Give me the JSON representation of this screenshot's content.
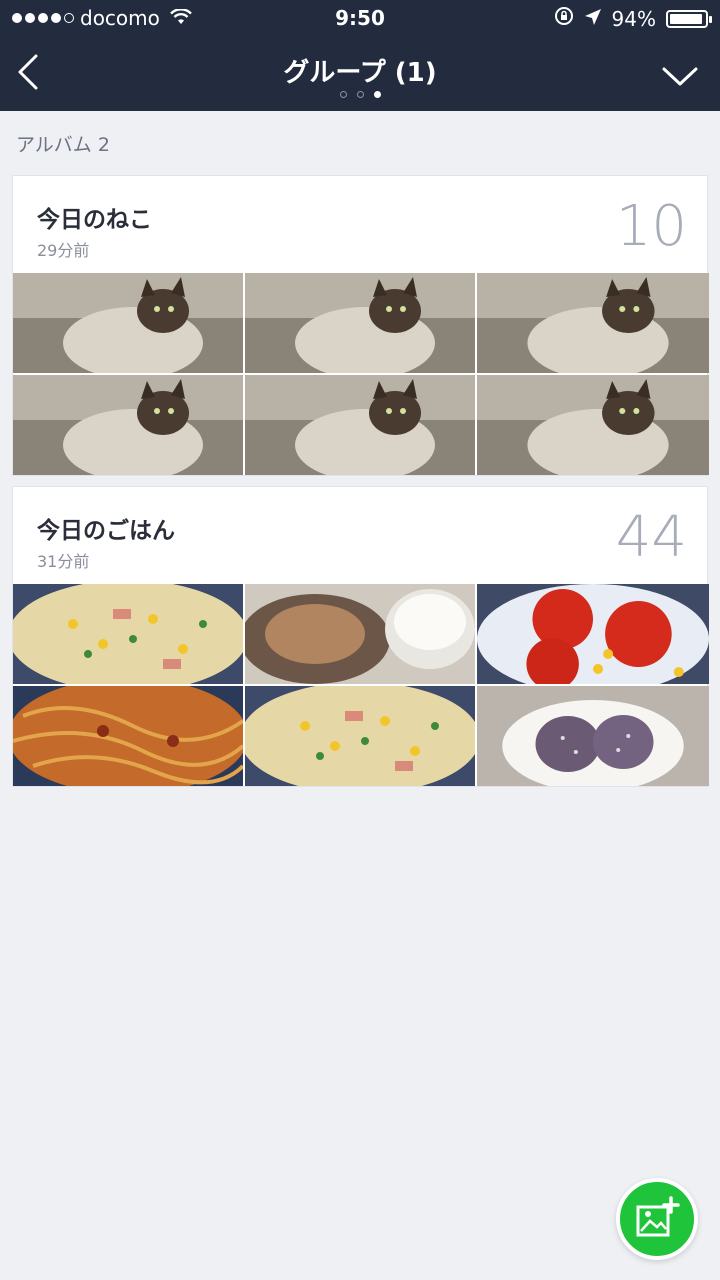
{
  "status_bar": {
    "carrier": "docomo",
    "time": "9:50",
    "battery": "94%",
    "battery_level": 0.94
  },
  "header": {
    "title": "グループ (1)",
    "page_count": 3,
    "active_page": 3
  },
  "album_count": "アルバム 2",
  "albums": [
    {
      "title": "今日のねこ",
      "time": "29分前",
      "count": "10",
      "photos": [
        "cat-photo",
        "cat-photo",
        "cat-photo",
        "cat-photo",
        "cat-photo",
        "cat-photo"
      ]
    },
    {
      "title": "今日のごはん",
      "time": "31分前",
      "count": "44",
      "photos": [
        "fried-rice-photo",
        "pork-and-rice-photo",
        "tomato-and-corn-photo",
        "spaghetti-photo",
        "fried-rice-photo",
        "onigiri-photo"
      ]
    }
  ],
  "icons": {
    "back": "chevron-left-icon",
    "menu": "chevron-down-icon",
    "fab": "add-image-icon"
  },
  "colors": {
    "header_bg": "#232b3f",
    "page_bg": "#eef0f4",
    "fab": "#1fc43a"
  }
}
